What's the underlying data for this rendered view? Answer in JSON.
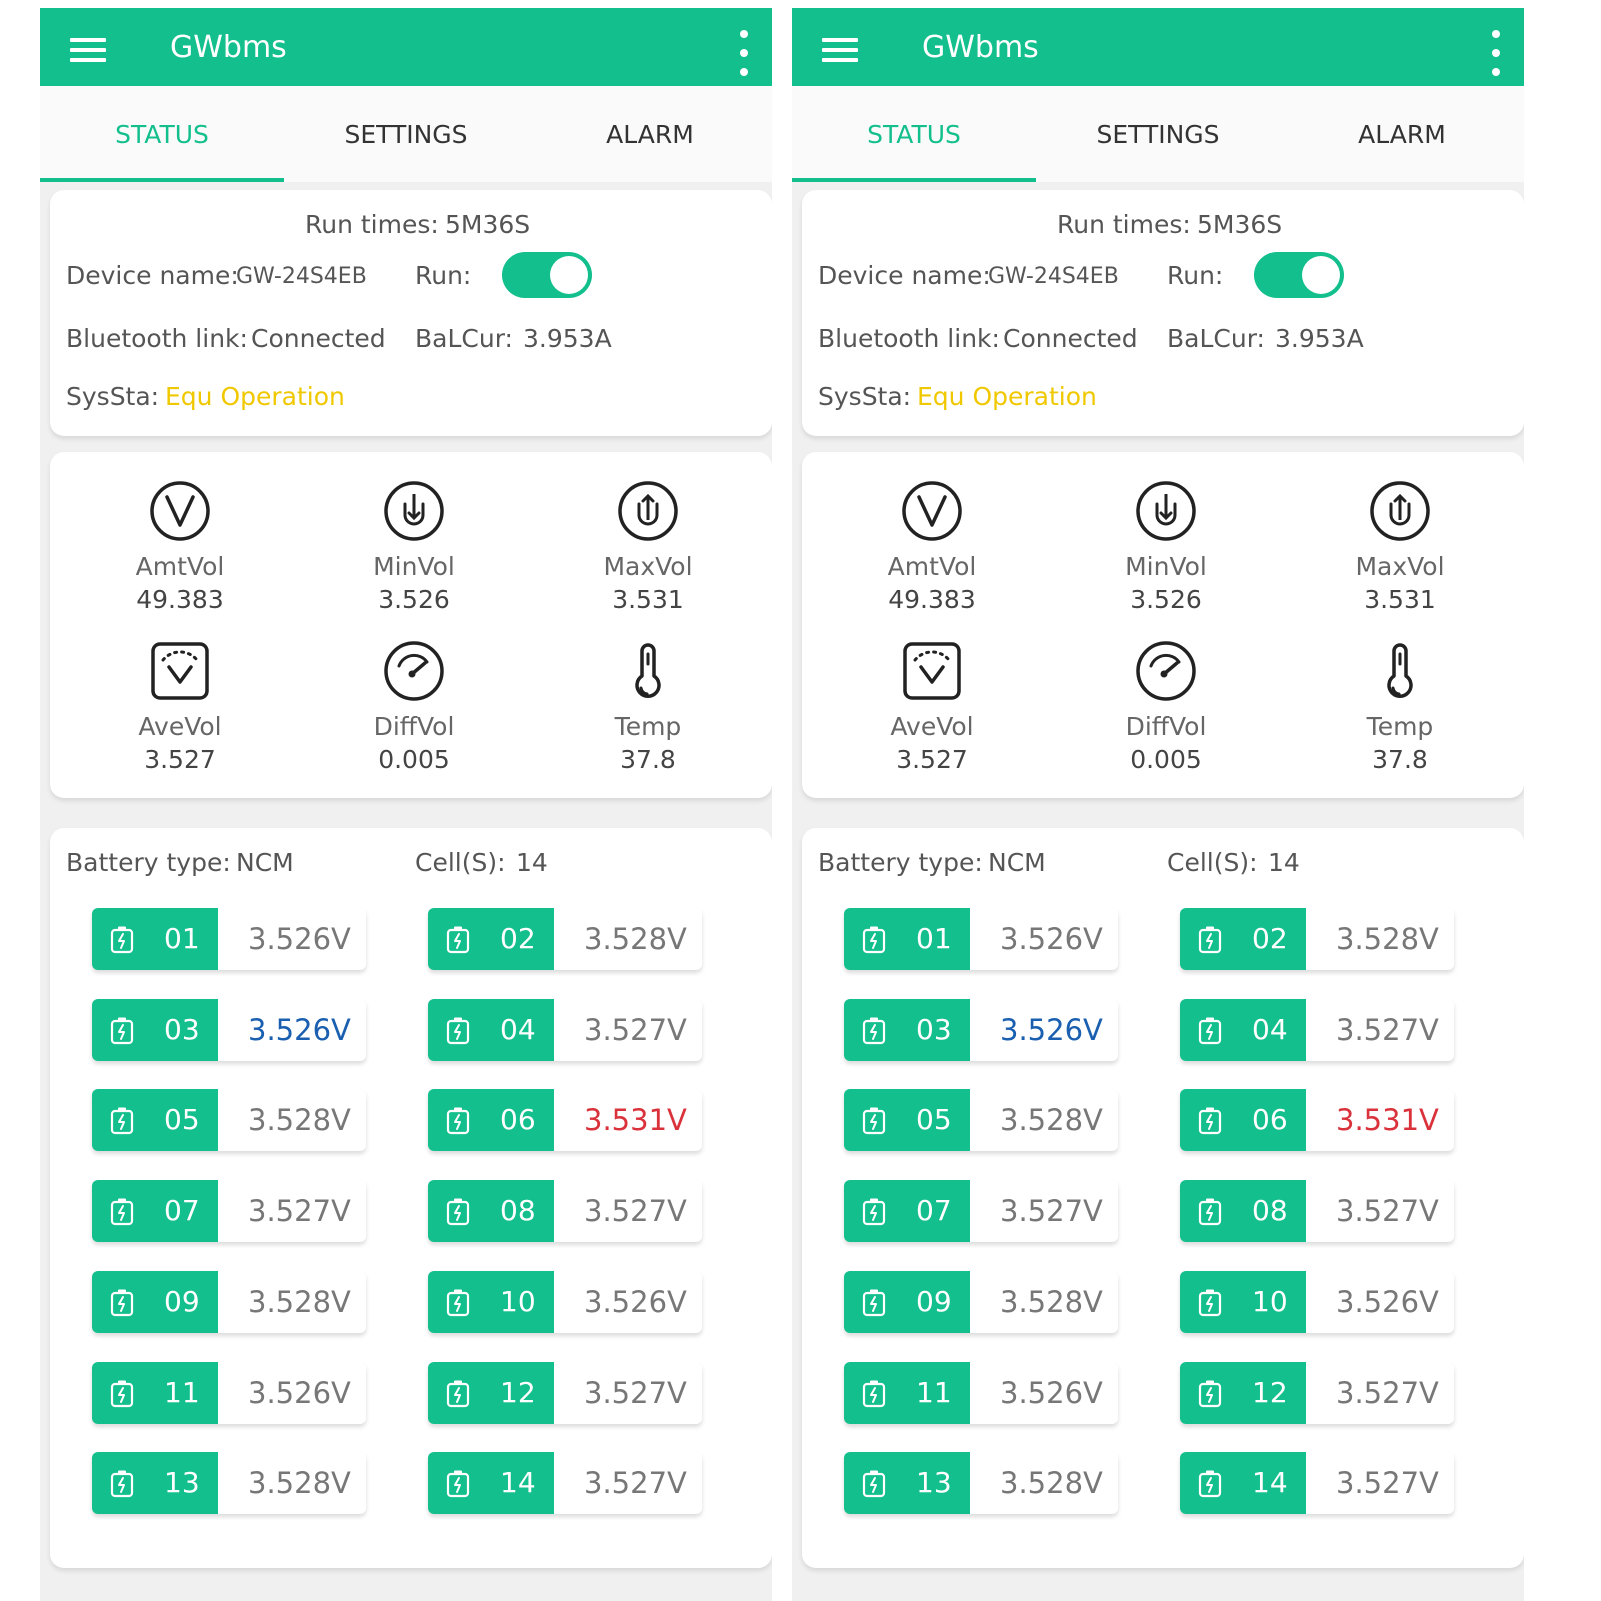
{
  "app": {
    "title": "GWbms"
  },
  "tabs": [
    "STATUS",
    "SETTINGS",
    "ALARM"
  ],
  "status": {
    "run_times_label": "Run times:",
    "run_times_value": "5M36S",
    "device_name_label": "Device name:",
    "device_name_value": "GW-24S4EB",
    "run_label": "Run:",
    "run_on": true,
    "bluetooth_label": "Bluetooth link:",
    "bluetooth_value": "Connected",
    "balcur_label": "BaLCur:",
    "balcur_value": "3.953A",
    "syssta_label": "SysSta:",
    "syssta_value": "Equ Operation"
  },
  "metrics": [
    {
      "label": "AmtVol",
      "value": "49.383",
      "icon": "voltage-icon"
    },
    {
      "label": "MinVol",
      "value": "3.526",
      "icon": "min-voltage-icon"
    },
    {
      "label": "MaxVol",
      "value": "3.531",
      "icon": "max-voltage-icon"
    },
    {
      "label": "AveVol",
      "value": "3.527",
      "icon": "average-voltage-icon"
    },
    {
      "label": "DiffVol",
      "value": "0.005",
      "icon": "gauge-icon"
    },
    {
      "label": "Temp",
      "value": "37.8",
      "icon": "thermometer-icon"
    }
  ],
  "battery": {
    "type_label": "Battery type:",
    "type_value": "NCM",
    "cells_label": "Cell(S):",
    "cells_value": "14"
  },
  "cells": [
    {
      "num": "01",
      "voltage": "3.526V",
      "status": "normal"
    },
    {
      "num": "02",
      "voltage": "3.528V",
      "status": "normal"
    },
    {
      "num": "03",
      "voltage": "3.526V",
      "status": "min"
    },
    {
      "num": "04",
      "voltage": "3.527V",
      "status": "normal"
    },
    {
      "num": "05",
      "voltage": "3.528V",
      "status": "normal"
    },
    {
      "num": "06",
      "voltage": "3.531V",
      "status": "max"
    },
    {
      "num": "07",
      "voltage": "3.527V",
      "status": "normal"
    },
    {
      "num": "08",
      "voltage": "3.527V",
      "status": "normal"
    },
    {
      "num": "09",
      "voltage": "3.528V",
      "status": "normal"
    },
    {
      "num": "10",
      "voltage": "3.526V",
      "status": "normal"
    },
    {
      "num": "11",
      "voltage": "3.526V",
      "status": "normal"
    },
    {
      "num": "12",
      "voltage": "3.527V",
      "status": "normal"
    },
    {
      "num": "13",
      "voltage": "3.528V",
      "status": "normal"
    },
    {
      "num": "14",
      "voltage": "3.527V",
      "status": "normal"
    }
  ],
  "colors": {
    "accent": "#13bf8c",
    "warning": "#f0c800",
    "min_cell": "#1a5fb0",
    "max_cell": "#d9323b"
  }
}
